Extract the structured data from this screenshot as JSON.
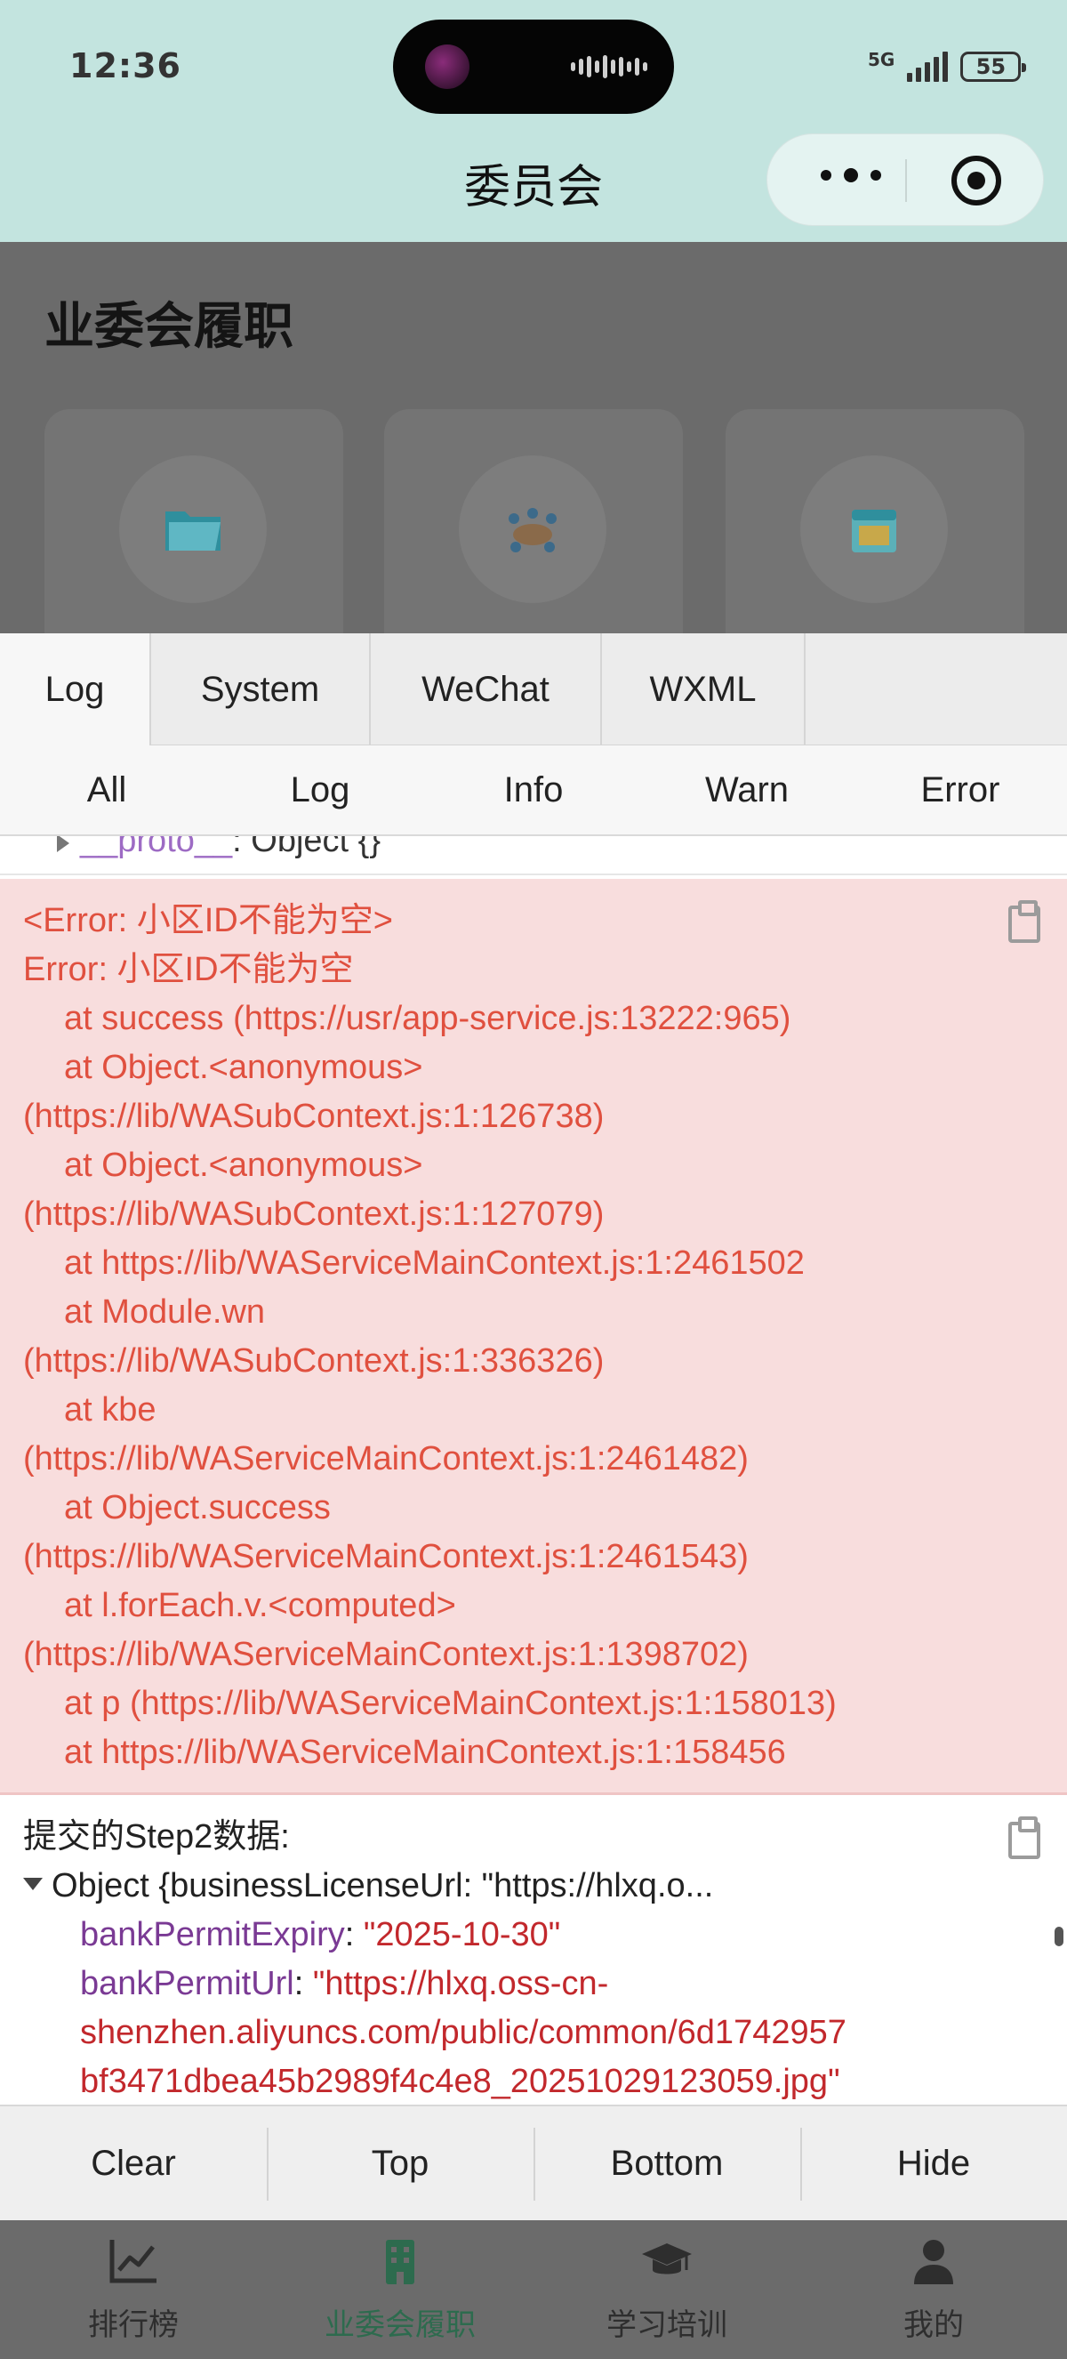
{
  "status_bar": {
    "time": "12:36",
    "network": "5G",
    "battery": "55"
  },
  "nav": {
    "title": "委员会"
  },
  "page": {
    "title": "业委会履职",
    "cards": [
      {
        "icon": "folder-icon"
      },
      {
        "icon": "meeting-icon"
      },
      {
        "icon": "calendar-icon"
      }
    ]
  },
  "vconsole": {
    "tabs": [
      "Log",
      "System",
      "WeChat",
      "WXML"
    ],
    "filters": [
      "All",
      "Log",
      "Info",
      "Warn",
      "Error"
    ],
    "proto_row": {
      "key": "__proto__",
      "value": ": Object {}"
    },
    "error_lines": [
      "<Error: 小区ID不能为空>",
      "Error: 小区ID不能为空",
      "at success (https://usr/app-service.js:13222:965)",
      "at Object.<anonymous>",
      "(https://lib/WASubContext.js:1:126738)",
      "at Object.<anonymous>",
      "(https://lib/WASubContext.js:1:127079)",
      "at https://lib/WAServiceMainContext.js:1:2461502",
      "at Module.wn",
      "(https://lib/WASubContext.js:1:336326)",
      "at kbe",
      "(https://lib/WAServiceMainContext.js:1:2461482)",
      "at Object.success",
      "(https://lib/WAServiceMainContext.js:1:2461543)",
      "at l.forEach.v.<computed>",
      "(https://lib/WAServiceMainContext.js:1:1398702)",
      "at p (https://lib/WAServiceMainContext.js:1:158013)",
      "at https://lib/WAServiceMainContext.js:1:158456"
    ],
    "data_log": {
      "label": "提交的Step2数据:",
      "object_summary": "Object {businessLicenseUrl: \"https://hlxq.o...",
      "fields": [
        {
          "key": "bankPermitExpiry",
          "sep": ": ",
          "value": "\"2025-10-30\""
        },
        {
          "key": "bankPermitUrl",
          "sep": ": ",
          "value": "\"https://hlxq.oss-cn-"
        }
      ],
      "continuation": [
        "shenzhen.aliyuncs.com/public/common/6d1742957",
        "bf3471dbea45b2989f4c4e8_20251029123059.jpg\""
      ]
    },
    "actions": [
      "Clear",
      "Top",
      "Bottom",
      "Hide"
    ]
  },
  "tabbar": {
    "items": [
      {
        "label": "排行榜",
        "icon": "chart-icon"
      },
      {
        "label": "业委会履职",
        "icon": "building-icon"
      },
      {
        "label": "学习培训",
        "icon": "graduation-cap-icon"
      },
      {
        "label": "我的",
        "icon": "user-icon"
      }
    ],
    "active_index": 1
  },
  "colors": {
    "header_bg": "#c3e4df",
    "error_text": "#e0503f",
    "error_bg": "#f8dddd",
    "active_tab": "#2d6b4e"
  }
}
